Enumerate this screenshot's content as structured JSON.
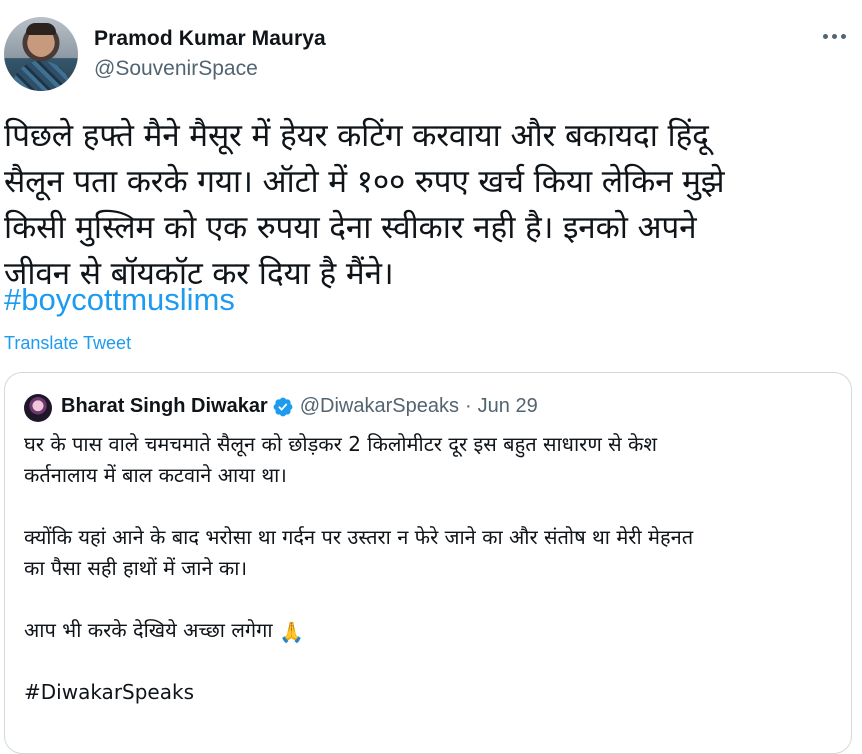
{
  "author": {
    "name": "Pramod Kumar Maurya",
    "handle": "@SouvenirSpace"
  },
  "more_icon": "more-horizontal-icon",
  "tweet": {
    "text": "पिछले हफ्ते मैने मैसूर में हेयर कटिंग करवाया और बकायदा हिंदू\nसैलून पता करके गया। ऑटो में १०० रुपए खर्च किया लेकिन मुझे\nकिसी मुस्लिम को एक रुपया देना स्वीकार नही है। इनको अपने\nजीवन से बॉयकॉट कर दिया है मैंने।",
    "hashtag": "#boycottmuslims",
    "translate": "Translate Tweet"
  },
  "quoted": {
    "name": "Bharat Singh Diwakar",
    "handle": "@DiwakarSpeaks",
    "separator": "·",
    "date": "Jun 29",
    "verified_icon": "verified-badge-icon",
    "para1": "घर के पास वाले चमचमाते सैलून को छोड़कर 2 किलोमीटर दूर इस बहुत साधारण से केश\nकर्तनालाय में बाल कटवाने आया था।",
    "para2": "क्योंकि यहां आने के बाद भरोसा था गर्दन पर उस्तरा न फेरे जाने का और संतोष था मेरी मेहनत\nका पैसा सही हाथों में जाने का।",
    "para3": "आप भी करके देखिये अच्छा लगेगा",
    "para3_emoji": "🙏",
    "hashtag": "#DiwakarSpeaks"
  },
  "colors": {
    "link": "#1d9bf0",
    "secondary_text": "#536471",
    "border": "#cfd9de"
  }
}
